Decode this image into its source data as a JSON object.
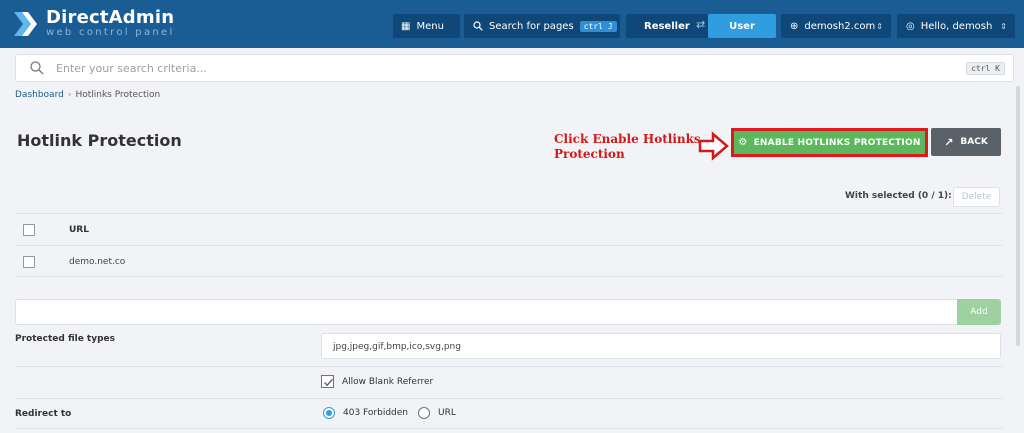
{
  "app": {
    "brand_name": "DirectAdmin",
    "brand_sub": "web control panel"
  },
  "topbar": {
    "menu_label": "Menu",
    "search_label": "Search for pages",
    "search_kbd": "ctrl J",
    "reseller_label": "Reseller",
    "user_label": "User",
    "domain_label": "demosh2.com",
    "hello_label": "Hello, demosh"
  },
  "search": {
    "placeholder": "Enter your search criteria...",
    "kbd": "ctrl K"
  },
  "breadcrumb": {
    "home": "Dashboard",
    "current": "Hotlinks Protection"
  },
  "page": {
    "title": "Hotlink Protection",
    "annotation": "Click Enable Hotlinks Protection",
    "enable_button": "ENABLE HOTLINKS PROTECTION",
    "back_button": "BACK"
  },
  "table": {
    "with_selected": "With selected (0 / 1):",
    "delete_label": "Delete",
    "column_url": "URL",
    "rows": [
      {
        "url": "demo.net.co"
      }
    ],
    "add_label": "Add"
  },
  "form": {
    "file_types_label": "Protected file types",
    "file_types_value": "jpg,jpeg,gif,bmp,ico,svg,png",
    "allow_blank_label": "Allow Blank Referrer",
    "allow_blank_checked": true,
    "redirect_label": "Redirect to",
    "redirect_options": [
      "403 Forbidden",
      "URL"
    ],
    "redirect_selected": "403 Forbidden"
  },
  "colors": {
    "topbar": "#1a5d95",
    "accent": "#2f9de0",
    "enable_green": "#5cb85c",
    "annotation_red": "#d21818"
  },
  "icons": {
    "brand": "chevron-logo-icon",
    "menu": "grid-icon",
    "search": "search-icon",
    "swap": "swap-icon",
    "domain": "globe-icon",
    "user": "user-circle-icon",
    "gear": "gear-icon",
    "back": "arrow-icon",
    "annotation": "right-arrow-icon"
  }
}
